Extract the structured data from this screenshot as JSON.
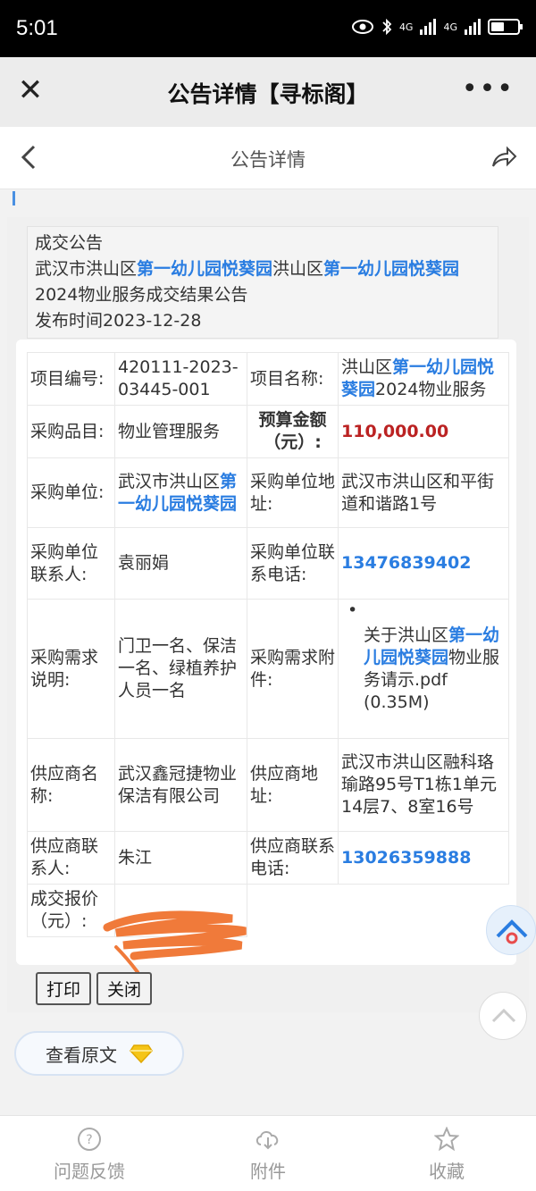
{
  "status_bar": {
    "time": "5:01",
    "network_1": "4G",
    "network_2": "4G"
  },
  "app_bar": {
    "title": "公告详情【寻标阁】"
  },
  "nav_bar": {
    "title": "公告详情"
  },
  "header": {
    "category": "成交公告",
    "title_parts": [
      "武汉市洪山区",
      "第一幼儿园悦葵园",
      "洪山区",
      "第一幼儿园悦葵园",
      "2024物业服务成交结果公告"
    ],
    "publish": "发布时间2023-12-28"
  },
  "table": {
    "project_no_label": "项目编号:",
    "project_no": "420111-2023-03445-001",
    "project_name_label": "项目名称:",
    "project_name_parts": [
      "洪山区",
      "第一幼儿园悦葵园",
      "2024物业服务"
    ],
    "category_label": "采购品目:",
    "category": "物业管理服务",
    "budget_label": "预算金额（元）:",
    "budget": "110,000.00",
    "buyer_label": "采购单位:",
    "buyer_parts": [
      "武汉市洪山区",
      "第一幼儿园悦葵园"
    ],
    "buyer_addr_label": "采购单位地址:",
    "buyer_addr": "武汉市洪山区和平街道和谐路1号",
    "contact_label": "采购单位联系人:",
    "contact": "袁丽娟",
    "contact_phone_label": "采购单位联系电话:",
    "contact_phone": "13476839402",
    "need_label": "采购需求说明:",
    "need": "门卫一名、保洁一名、绿植养护人员一名",
    "need_attach_label": "采购需求附件:",
    "attach_parts": [
      "关于洪山区",
      "第一幼儿园悦葵园",
      "物业服务请示.pdf (0.35M)"
    ],
    "supplier_label": "供应商名称:",
    "supplier": "武汉鑫冠捷物业保洁有限公司",
    "supplier_addr_label": "供应商地址:",
    "supplier_addr": "武汉市洪山区融科珞瑜路95号T1栋1单元14层7、8室16号",
    "supplier_contact_label": "供应商联系人:",
    "supplier_contact": "朱江",
    "supplier_phone_label": "供应商联系电话:",
    "supplier_phone": "13026359888",
    "deal_price_label": "成交报价（元）:"
  },
  "buttons": {
    "print": "打印",
    "close": "关闭",
    "view_original": "查看原文"
  },
  "tabbar": {
    "feedback": "问题反馈",
    "attachment": "附件",
    "favorite": "收藏"
  },
  "colors": {
    "link": "#2a7de1",
    "money": "#bb2222",
    "scribble": "#f07a3a"
  },
  "icons": [
    "close-icon",
    "more-icon",
    "back-icon",
    "share-icon",
    "diamond-icon",
    "question-icon",
    "cloud-download-icon",
    "star-icon",
    "chevron-up-icon"
  ]
}
